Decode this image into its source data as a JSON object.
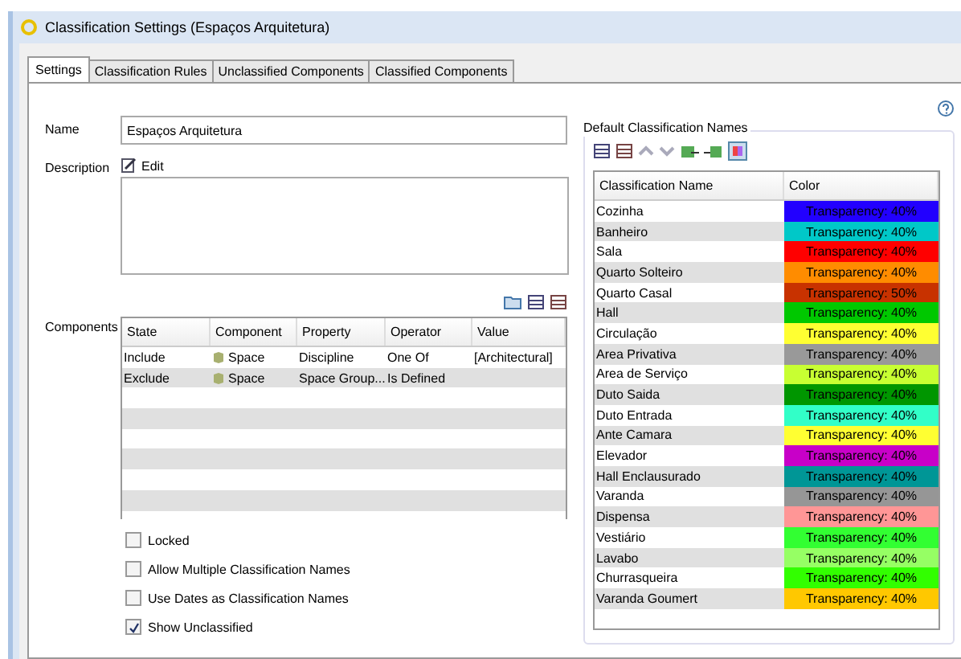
{
  "window": {
    "title": "Classification Settings (Espaços Arquitetura)"
  },
  "tabs": [
    {
      "label": "Settings",
      "selected": true
    },
    {
      "label": "Classification Rules",
      "selected": false
    },
    {
      "label": "Unclassified Components",
      "selected": false
    },
    {
      "label": "Classified Components",
      "selected": false
    }
  ],
  "name": {
    "label": "Name",
    "value": "Espaços Arquitetura"
  },
  "description": {
    "label": "Description",
    "edit": "Edit"
  },
  "components": {
    "label": "Components",
    "columns": [
      "State",
      "Component",
      "Property",
      "Operator",
      "Value"
    ],
    "rows": [
      [
        "Include",
        "Space",
        "Discipline",
        "One Of",
        "[Architectural]"
      ],
      [
        "Exclude",
        "Space",
        "Space Group...",
        "Is Defined",
        ""
      ]
    ]
  },
  "options": [
    {
      "label": "Locked",
      "checked": false
    },
    {
      "label": "Allow Multiple Classification Names",
      "checked": false
    },
    {
      "label": "Use Dates as Classification Names",
      "checked": false
    },
    {
      "label": "Show Unclassified",
      "checked": true
    }
  ],
  "default_names": {
    "title": "Default Classification Names",
    "columns": [
      "Classification Name",
      "Color"
    ],
    "rows": [
      {
        "name": "Cozinha",
        "color": "#2200ff",
        "text": "Transparency: 40%"
      },
      {
        "name": "Banheiro",
        "color": "#00c8c8",
        "text": "Transparency: 40%"
      },
      {
        "name": "Sala",
        "color": "#ff0000",
        "text": "Transparency: 40%"
      },
      {
        "name": "Quarto Solteiro",
        "color": "#ff8c00",
        "text": "Transparency: 40%"
      },
      {
        "name": "Quarto Casal",
        "color": "#c83200",
        "text": "Transparency: 50%"
      },
      {
        "name": "Hall",
        "color": "#00c800",
        "text": "Transparency: 40%"
      },
      {
        "name": "Circulação",
        "color": "#ffff32",
        "text": "Transparency: 40%"
      },
      {
        "name": "Area Privativa",
        "color": "#999999",
        "text": "Transparency: 40%"
      },
      {
        "name": "Area de Serviço",
        "color": "#c8ff32",
        "text": "Transparency: 40%"
      },
      {
        "name": "Duto Saida",
        "color": "#009600",
        "text": "Transparency: 40%"
      },
      {
        "name": "Duto Entrada",
        "color": "#32ffc8",
        "text": "Transparency: 40%"
      },
      {
        "name": "Ante Camara",
        "color": "#ffff32",
        "text": "Transparency: 40%"
      },
      {
        "name": "Elevador",
        "color": "#c800c8",
        "text": "Transparency: 40%"
      },
      {
        "name": "Hall Enclausurado",
        "color": "#009696",
        "text": "Transparency: 40%"
      },
      {
        "name": "Varanda",
        "color": "#969696",
        "text": "Transparency: 40%"
      },
      {
        "name": "Dispensa",
        "color": "#ff9696",
        "text": "Transparency: 40%"
      },
      {
        "name": "Vestiário",
        "color": "#32ff32",
        "text": "Transparency: 40%"
      },
      {
        "name": "Lavabo",
        "color": "#96ff64",
        "text": "Transparency: 40%"
      },
      {
        "name": "Churrasqueira",
        "color": "#32ff00",
        "text": "Transparency: 40%"
      },
      {
        "name": "Varanda Goumert",
        "color": "#ffc800",
        "text": "Transparency: 40%"
      }
    ]
  }
}
